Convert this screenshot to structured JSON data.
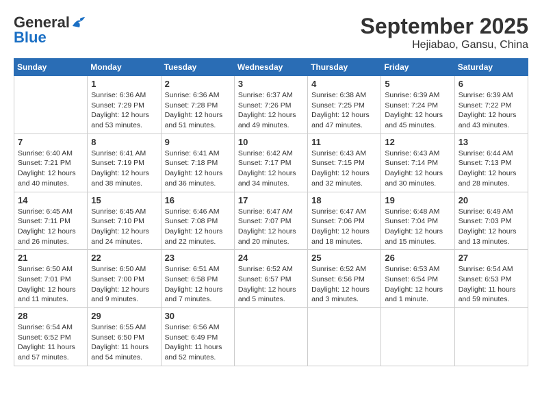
{
  "logo": {
    "line1": "General",
    "line2": "Blue"
  },
  "title": "September 2025",
  "subtitle": "Hejiabao, Gansu, China",
  "days_of_week": [
    "Sunday",
    "Monday",
    "Tuesday",
    "Wednesday",
    "Thursday",
    "Friday",
    "Saturday"
  ],
  "weeks": [
    [
      {
        "day": "",
        "info": ""
      },
      {
        "day": "1",
        "info": "Sunrise: 6:36 AM\nSunset: 7:29 PM\nDaylight: 12 hours\nand 53 minutes."
      },
      {
        "day": "2",
        "info": "Sunrise: 6:36 AM\nSunset: 7:28 PM\nDaylight: 12 hours\nand 51 minutes."
      },
      {
        "day": "3",
        "info": "Sunrise: 6:37 AM\nSunset: 7:26 PM\nDaylight: 12 hours\nand 49 minutes."
      },
      {
        "day": "4",
        "info": "Sunrise: 6:38 AM\nSunset: 7:25 PM\nDaylight: 12 hours\nand 47 minutes."
      },
      {
        "day": "5",
        "info": "Sunrise: 6:39 AM\nSunset: 7:24 PM\nDaylight: 12 hours\nand 45 minutes."
      },
      {
        "day": "6",
        "info": "Sunrise: 6:39 AM\nSunset: 7:22 PM\nDaylight: 12 hours\nand 43 minutes."
      }
    ],
    [
      {
        "day": "7",
        "info": "Sunrise: 6:40 AM\nSunset: 7:21 PM\nDaylight: 12 hours\nand 40 minutes."
      },
      {
        "day": "8",
        "info": "Sunrise: 6:41 AM\nSunset: 7:19 PM\nDaylight: 12 hours\nand 38 minutes."
      },
      {
        "day": "9",
        "info": "Sunrise: 6:41 AM\nSunset: 7:18 PM\nDaylight: 12 hours\nand 36 minutes."
      },
      {
        "day": "10",
        "info": "Sunrise: 6:42 AM\nSunset: 7:17 PM\nDaylight: 12 hours\nand 34 minutes."
      },
      {
        "day": "11",
        "info": "Sunrise: 6:43 AM\nSunset: 7:15 PM\nDaylight: 12 hours\nand 32 minutes."
      },
      {
        "day": "12",
        "info": "Sunrise: 6:43 AM\nSunset: 7:14 PM\nDaylight: 12 hours\nand 30 minutes."
      },
      {
        "day": "13",
        "info": "Sunrise: 6:44 AM\nSunset: 7:13 PM\nDaylight: 12 hours\nand 28 minutes."
      }
    ],
    [
      {
        "day": "14",
        "info": "Sunrise: 6:45 AM\nSunset: 7:11 PM\nDaylight: 12 hours\nand 26 minutes."
      },
      {
        "day": "15",
        "info": "Sunrise: 6:45 AM\nSunset: 7:10 PM\nDaylight: 12 hours\nand 24 minutes."
      },
      {
        "day": "16",
        "info": "Sunrise: 6:46 AM\nSunset: 7:08 PM\nDaylight: 12 hours\nand 22 minutes."
      },
      {
        "day": "17",
        "info": "Sunrise: 6:47 AM\nSunset: 7:07 PM\nDaylight: 12 hours\nand 20 minutes."
      },
      {
        "day": "18",
        "info": "Sunrise: 6:47 AM\nSunset: 7:06 PM\nDaylight: 12 hours\nand 18 minutes."
      },
      {
        "day": "19",
        "info": "Sunrise: 6:48 AM\nSunset: 7:04 PM\nDaylight: 12 hours\nand 15 minutes."
      },
      {
        "day": "20",
        "info": "Sunrise: 6:49 AM\nSunset: 7:03 PM\nDaylight: 12 hours\nand 13 minutes."
      }
    ],
    [
      {
        "day": "21",
        "info": "Sunrise: 6:50 AM\nSunset: 7:01 PM\nDaylight: 12 hours\nand 11 minutes."
      },
      {
        "day": "22",
        "info": "Sunrise: 6:50 AM\nSunset: 7:00 PM\nDaylight: 12 hours\nand 9 minutes."
      },
      {
        "day": "23",
        "info": "Sunrise: 6:51 AM\nSunset: 6:58 PM\nDaylight: 12 hours\nand 7 minutes."
      },
      {
        "day": "24",
        "info": "Sunrise: 6:52 AM\nSunset: 6:57 PM\nDaylight: 12 hours\nand 5 minutes."
      },
      {
        "day": "25",
        "info": "Sunrise: 6:52 AM\nSunset: 6:56 PM\nDaylight: 12 hours\nand 3 minutes."
      },
      {
        "day": "26",
        "info": "Sunrise: 6:53 AM\nSunset: 6:54 PM\nDaylight: 12 hours\nand 1 minute."
      },
      {
        "day": "27",
        "info": "Sunrise: 6:54 AM\nSunset: 6:53 PM\nDaylight: 11 hours\nand 59 minutes."
      }
    ],
    [
      {
        "day": "28",
        "info": "Sunrise: 6:54 AM\nSunset: 6:52 PM\nDaylight: 11 hours\nand 57 minutes."
      },
      {
        "day": "29",
        "info": "Sunrise: 6:55 AM\nSunset: 6:50 PM\nDaylight: 11 hours\nand 54 minutes."
      },
      {
        "day": "30",
        "info": "Sunrise: 6:56 AM\nSunset: 6:49 PM\nDaylight: 11 hours\nand 52 minutes."
      },
      {
        "day": "",
        "info": ""
      },
      {
        "day": "",
        "info": ""
      },
      {
        "day": "",
        "info": ""
      },
      {
        "day": "",
        "info": ""
      }
    ]
  ]
}
